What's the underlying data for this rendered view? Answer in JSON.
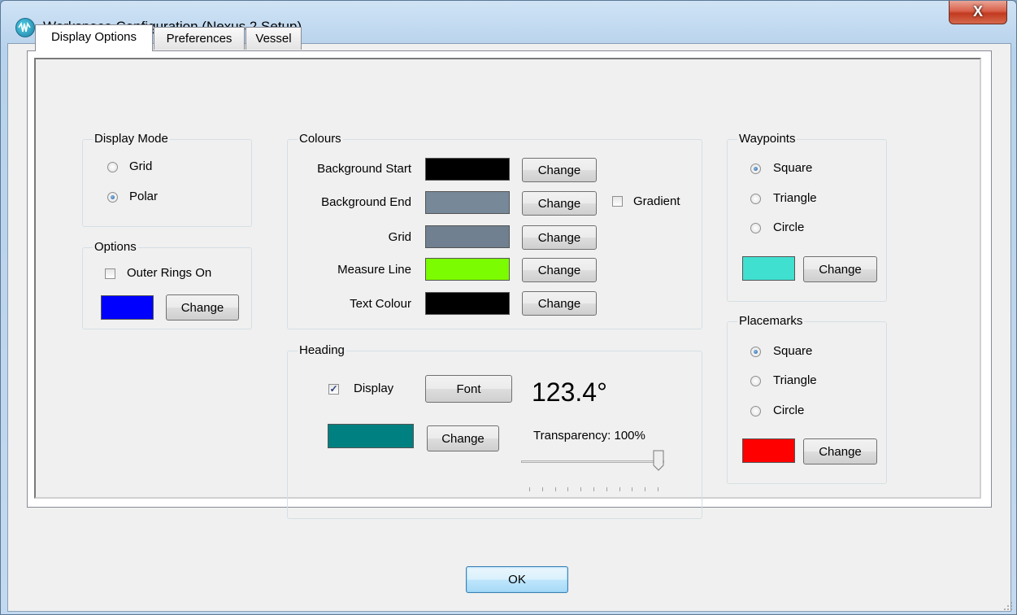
{
  "window": {
    "title": "Workspace Configuration (Nexus 2 Setup)",
    "close_glyph": "X",
    "app_icon": "nexus-waveform-icon"
  },
  "tabs": [
    {
      "label": "Display Options",
      "active": true
    },
    {
      "label": "Preferences",
      "active": false
    },
    {
      "label": "Vessel",
      "active": false
    }
  ],
  "display_mode": {
    "legend": "Display Mode",
    "options": [
      {
        "label": "Grid",
        "selected": false
      },
      {
        "label": "Polar",
        "selected": true
      }
    ]
  },
  "options": {
    "legend": "Options",
    "outer_rings_label": "Outer Rings On",
    "outer_rings_checked": false,
    "color": "#0000ff",
    "change_label": "Change"
  },
  "colours": {
    "legend": "Colours",
    "rows": [
      {
        "label": "Background Start",
        "color": "#000000",
        "button": "Change"
      },
      {
        "label": "Background End",
        "color": "#778899",
        "button": "Change"
      },
      {
        "label": "Grid",
        "color": "#708090",
        "button": "Change"
      },
      {
        "label": "Measure Line",
        "color": "#7cfc00",
        "button": "Change"
      },
      {
        "label": "Text Colour",
        "color": "#000000",
        "button": "Change"
      }
    ],
    "gradient_label": "Gradient",
    "gradient_checked": false
  },
  "heading": {
    "legend": "Heading",
    "display_label": "Display",
    "display_checked": true,
    "font_button": "Font",
    "value": "123.4°",
    "color": "#008080",
    "change_label": "Change",
    "transparency_label": "Transparency: 100%",
    "transparency": 1.0
  },
  "waypoints": {
    "legend": "Waypoints",
    "options": [
      {
        "label": "Square",
        "selected": true
      },
      {
        "label": "Triangle",
        "selected": false
      },
      {
        "label": "Circle",
        "selected": false
      }
    ],
    "color": "#40e0d0",
    "change_label": "Change"
  },
  "placemarks": {
    "legend": "Placemarks",
    "options": [
      {
        "label": "Square",
        "selected": true
      },
      {
        "label": "Triangle",
        "selected": false
      },
      {
        "label": "Circle",
        "selected": false
      }
    ],
    "color": "#ff0000",
    "change_label": "Change"
  },
  "ok_label": "OK"
}
